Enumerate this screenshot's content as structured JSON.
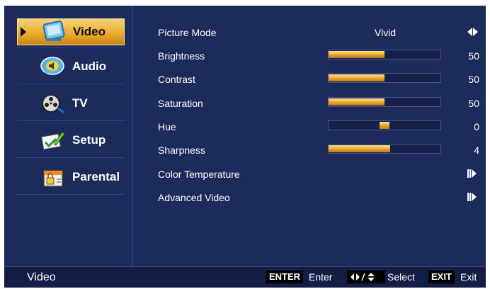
{
  "sidebar": {
    "items": [
      {
        "label": "Video",
        "icon": "video-icon",
        "selected": true
      },
      {
        "label": "Audio",
        "icon": "audio-icon",
        "selected": false
      },
      {
        "label": "TV",
        "icon": "tv-reel-icon",
        "selected": false
      },
      {
        "label": "Setup",
        "icon": "setup-icon",
        "selected": false
      },
      {
        "label": "Parental",
        "icon": "parental-lock-icon",
        "selected": false
      }
    ]
  },
  "settings": {
    "picture_mode": {
      "label": "Picture Mode",
      "value": "Vivid"
    },
    "brightness": {
      "label": "Brightness",
      "value": "50",
      "level": 0.5
    },
    "contrast": {
      "label": "Contrast",
      "value": "50",
      "level": 0.5
    },
    "saturation": {
      "label": "Saturation",
      "value": "50",
      "level": 0.5
    },
    "hue": {
      "label": "Hue",
      "value": "0",
      "level": 0.5
    },
    "sharpness": {
      "label": "Sharpness",
      "value": "4",
      "level": 0.55
    },
    "color_temperature": {
      "label": "Color Temperature"
    },
    "advanced_video": {
      "label": "Advanced Video"
    }
  },
  "footer": {
    "title": "Video",
    "enter_key": "ENTER",
    "enter_label": "Enter",
    "select_label": "Select",
    "exit_key": "EXIT",
    "exit_label": "Exit"
  },
  "colors": {
    "background": "#1d2a5c",
    "accent": "#e8a92a"
  }
}
